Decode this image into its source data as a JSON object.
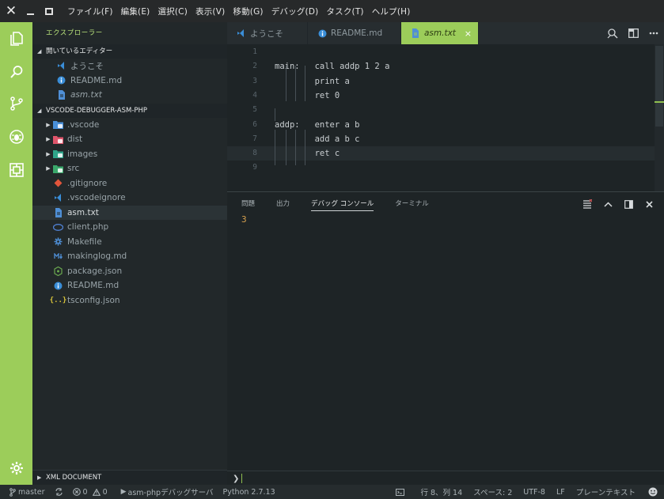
{
  "menu": [
    "ファイル(F)",
    "編集(E)",
    "選択(C)",
    "表示(V)",
    "移動(G)",
    "デバッグ(D)",
    "タスク(T)",
    "ヘルプ(H)"
  ],
  "activity_icons": [
    "files-icon",
    "search-icon",
    "source-control-icon",
    "debug-icon",
    "extensions-icon",
    "settings-gear-icon"
  ],
  "sidebar": {
    "title": "エクスプローラー",
    "open_editors_header": "開いているエディター",
    "open_editors": [
      {
        "label": "ようこそ",
        "icon": "vscode-icon",
        "color": "#3a8ed8"
      },
      {
        "label": "README.md",
        "icon": "info-icon",
        "color": "#3a8ed8"
      },
      {
        "label": "asm.txt",
        "icon": "file-text-icon",
        "color": "#4f8fd6"
      }
    ],
    "project_header": "VSCODE-DEBUGGER-ASM-PHP",
    "tree": [
      {
        "label": ".vscode",
        "icon": "folder-vscode-icon",
        "color": "#4a90d9",
        "folder": true
      },
      {
        "label": "dist",
        "icon": "folder-dist-icon",
        "color": "#e0556b",
        "folder": true
      },
      {
        "label": "images",
        "icon": "folder-images-icon",
        "color": "#2fa58a",
        "folder": true
      },
      {
        "label": "src",
        "icon": "folder-src-icon",
        "color": "#3aa86b",
        "folder": true
      },
      {
        "label": ".gitignore",
        "icon": "git-icon",
        "color": "#e2553b",
        "folder": false
      },
      {
        "label": ".vscodeignore",
        "icon": "vscode-icon",
        "color": "#3a8ed8",
        "folder": false
      },
      {
        "label": "asm.txt",
        "icon": "file-text-icon",
        "color": "#4f8fd6",
        "folder": false
      },
      {
        "label": "client.php",
        "icon": "php-icon",
        "color": "#4f7fd0",
        "folder": false
      },
      {
        "label": "Makefile",
        "icon": "gear-file-icon",
        "color": "#4f8fd6",
        "folder": false
      },
      {
        "label": "makinglog.md",
        "icon": "markdown-icon",
        "color": "#4f8fd6",
        "folder": false
      },
      {
        "label": "package.json",
        "icon": "nodejs-icon",
        "color": "#6aa84f",
        "folder": false
      },
      {
        "label": "README.md",
        "icon": "info-icon",
        "color": "#3a8ed8",
        "folder": false
      },
      {
        "label": "tsconfig.json",
        "icon": "json-icon",
        "color": "#d7c33a",
        "folder": false
      }
    ],
    "xml_header": "XML DOCUMENT"
  },
  "tabs": [
    {
      "label": "ようこそ",
      "icon": "vscode-icon"
    },
    {
      "label": "README.md",
      "icon": "info-icon"
    },
    {
      "label": "asm.txt",
      "icon": "file-text-icon",
      "close": "×"
    }
  ],
  "editor": {
    "lines": [
      {
        "n": "1",
        "text": ""
      },
      {
        "n": "2",
        "text": "main:   call addp 1 2 a"
      },
      {
        "n": "3",
        "text": "        print a"
      },
      {
        "n": "4",
        "text": "        ret 0"
      },
      {
        "n": "5",
        "text": ""
      },
      {
        "n": "6",
        "text": "addp:   enter a b"
      },
      {
        "n": "7",
        "text": "        add a b c"
      },
      {
        "n": "8",
        "text": "        ret c"
      },
      {
        "n": "9",
        "text": ""
      }
    ]
  },
  "panel": {
    "tabs": [
      "問題",
      "出力",
      "デバッグ コンソール",
      "ターミナル"
    ],
    "output": "3",
    "prompt": "❯"
  },
  "statusbar": {
    "branch": "master",
    "errors": "0",
    "warnings": "0",
    "debug_config": "asm-phpデバッグサーバ",
    "python": "Python 2.7.13",
    "position": "行 8、列 14",
    "spaces": "スペース: 2",
    "encoding": "UTF-8",
    "eol": "LF",
    "language": "プレーンテキスト"
  },
  "colors": {
    "accent": "#9ccd5a",
    "editor_bg": "#1e2426",
    "sidebar_bg": "#22282a"
  }
}
